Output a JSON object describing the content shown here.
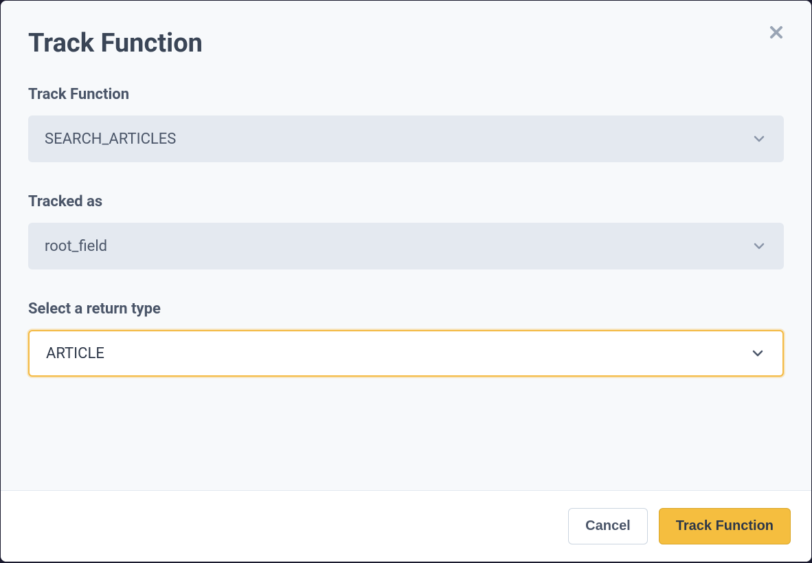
{
  "modal": {
    "title": "Track Function",
    "fields": {
      "track_function": {
        "label": "Track Function",
        "value": "SEARCH_ARTICLES"
      },
      "tracked_as": {
        "label": "Tracked as",
        "value": "root_field"
      },
      "return_type": {
        "label": "Select a return type",
        "value": "ARTICLE"
      }
    },
    "actions": {
      "cancel": "Cancel",
      "submit": "Track Function"
    }
  }
}
